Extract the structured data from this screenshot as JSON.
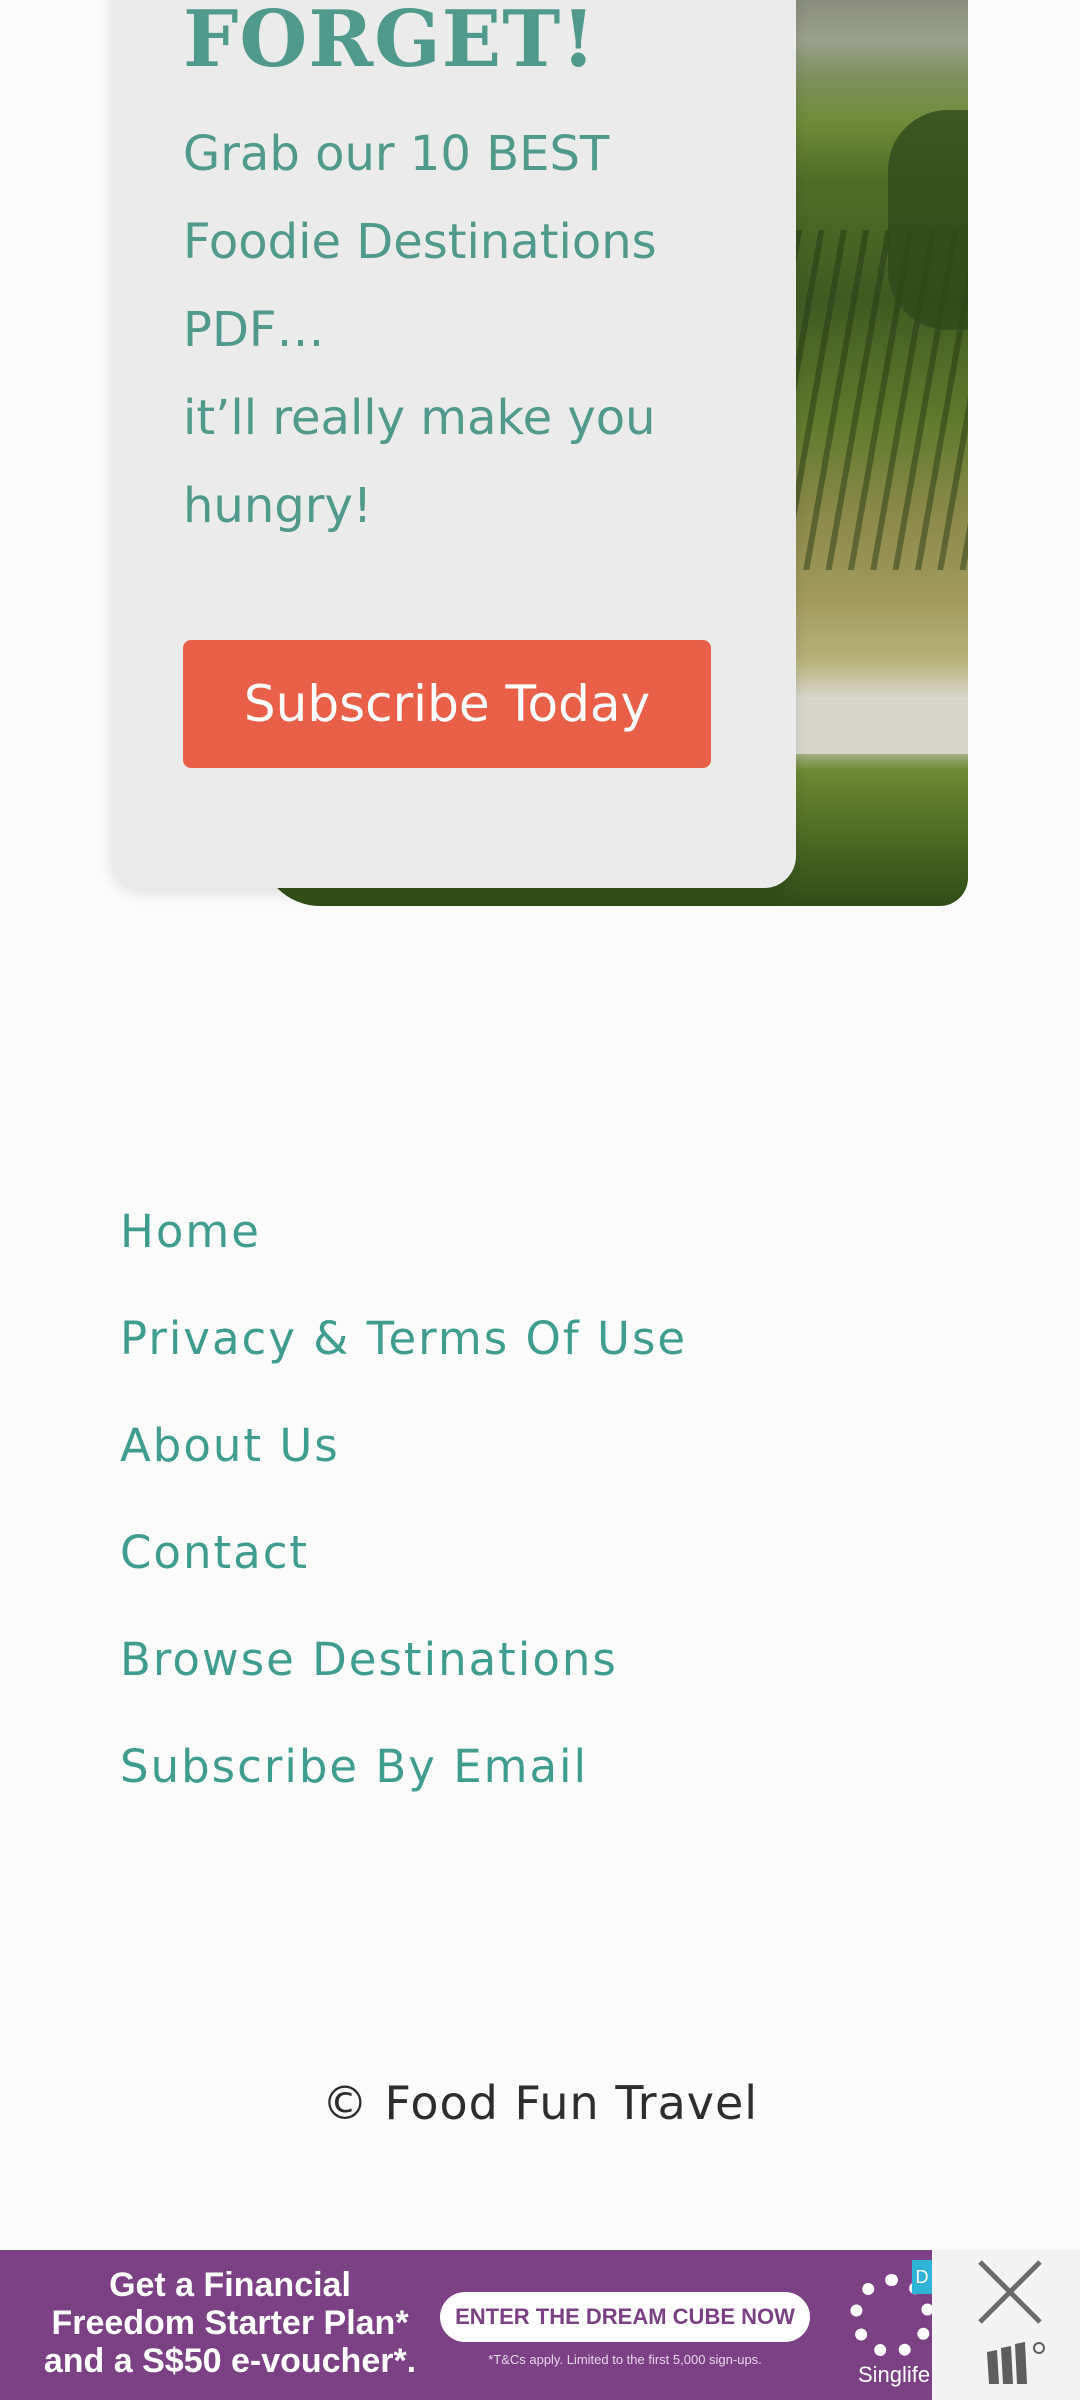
{
  "promo": {
    "title": "FORGET!",
    "lines": [
      "Grab our 10 BEST",
      "Foodie Destinations",
      "PDF…",
      "it’ll really make you",
      "hungry!"
    ],
    "button_label": "Subscribe Today"
  },
  "footer_nav": {
    "items": [
      "Home",
      "Privacy & Terms Of Use",
      "About Us",
      "Contact",
      "Browse Destinations",
      "Subscribe By Email"
    ]
  },
  "copyright": "© Food Fun Travel",
  "ad": {
    "headline_lines": [
      "Get a Financial",
      "Freedom Starter Plan*",
      "and a S$50 e-voucher*."
    ],
    "cta": "ENTER THE DREAM CUBE NOW",
    "fine_print": "*T&Cs apply. Limited to the first 5,000 sign-ups.",
    "brand": "Singlife",
    "badge": "D",
    "close_icon": "close-icon",
    "mark_icon": "ad-network-icon"
  },
  "colors": {
    "accent_teal": "#4f9a8a",
    "button_orange": "#e95f47",
    "ad_purple": "#7b4184"
  }
}
